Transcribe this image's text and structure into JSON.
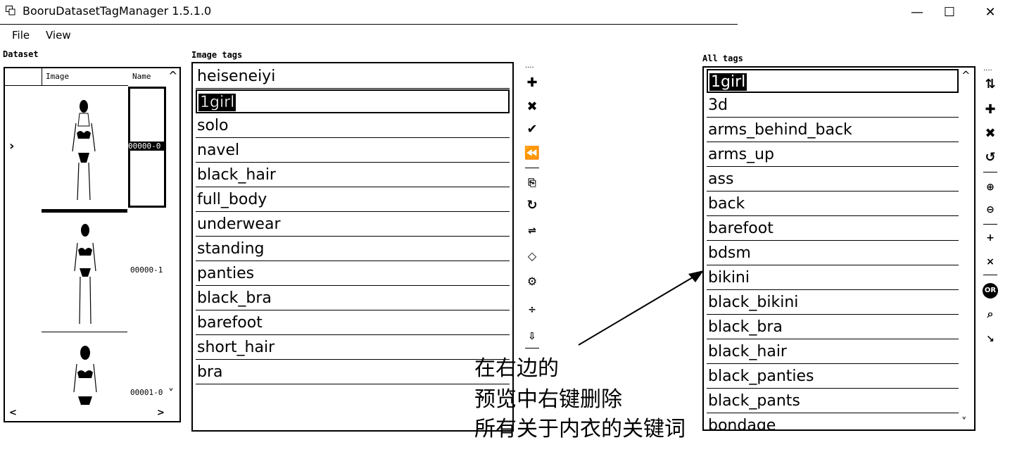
{
  "window": {
    "title": "BooruDatasetTagManager 1.5.1.0",
    "minimize": "—",
    "maximize": "☐",
    "close": "✕"
  },
  "menu": [
    "File",
    "View"
  ],
  "dataset": {
    "label": "Dataset",
    "columns": {
      "image": "Image",
      "name": "Name"
    },
    "rows": [
      {
        "name": "00000-0",
        "selected": true
      },
      {
        "name": "00000-1",
        "selected": false
      },
      {
        "name": "00001-0",
        "selected": false
      }
    ],
    "scroll_up": "^",
    "scroll_down": "˅",
    "scroll_left": "<",
    "scroll_right": ">",
    "row_pointer": "›"
  },
  "image_tags": {
    "label": "Image tags",
    "selected_index": 1,
    "items": [
      "heiseneiyi",
      "1girl",
      "solo",
      "navel",
      "black_hair",
      "full_body",
      "underwear",
      "standing",
      "panties",
      "black_bra",
      "barefoot",
      "short_hair",
      "bra"
    ]
  },
  "all_tags": {
    "label": "All tags",
    "selected_index": 0,
    "items": [
      "1girl",
      "3d",
      "arms_behind_back",
      "arms_up",
      "ass",
      "back",
      "barefoot",
      "bdsm",
      "bikini",
      "black_bikini",
      "black_bra",
      "black_hair",
      "black_panties",
      "black_pants",
      "bondage"
    ]
  },
  "annotation": {
    "lines": [
      "在右边的",
      "预览中右键删除",
      "所有关于内衣的关键词"
    ]
  },
  "icons": {
    "middle_toolbar": [
      "add-icon",
      "delete-icon",
      "apply-icon",
      "undo-icon",
      "copy-icon",
      "refresh-icon",
      "sort-icon",
      "tag-icon",
      "settings-icon",
      "split-icon",
      "move-down-icon"
    ],
    "right_toolbar": [
      "sync-icon",
      "add-icon",
      "delete-icon",
      "replace-icon",
      "add-to-selected-icon",
      "remove-from-selected-icon",
      "add-all-icon",
      "remove-all-icon",
      "or-filter-icon",
      "search-icon",
      "clear-filter-icon"
    ]
  }
}
